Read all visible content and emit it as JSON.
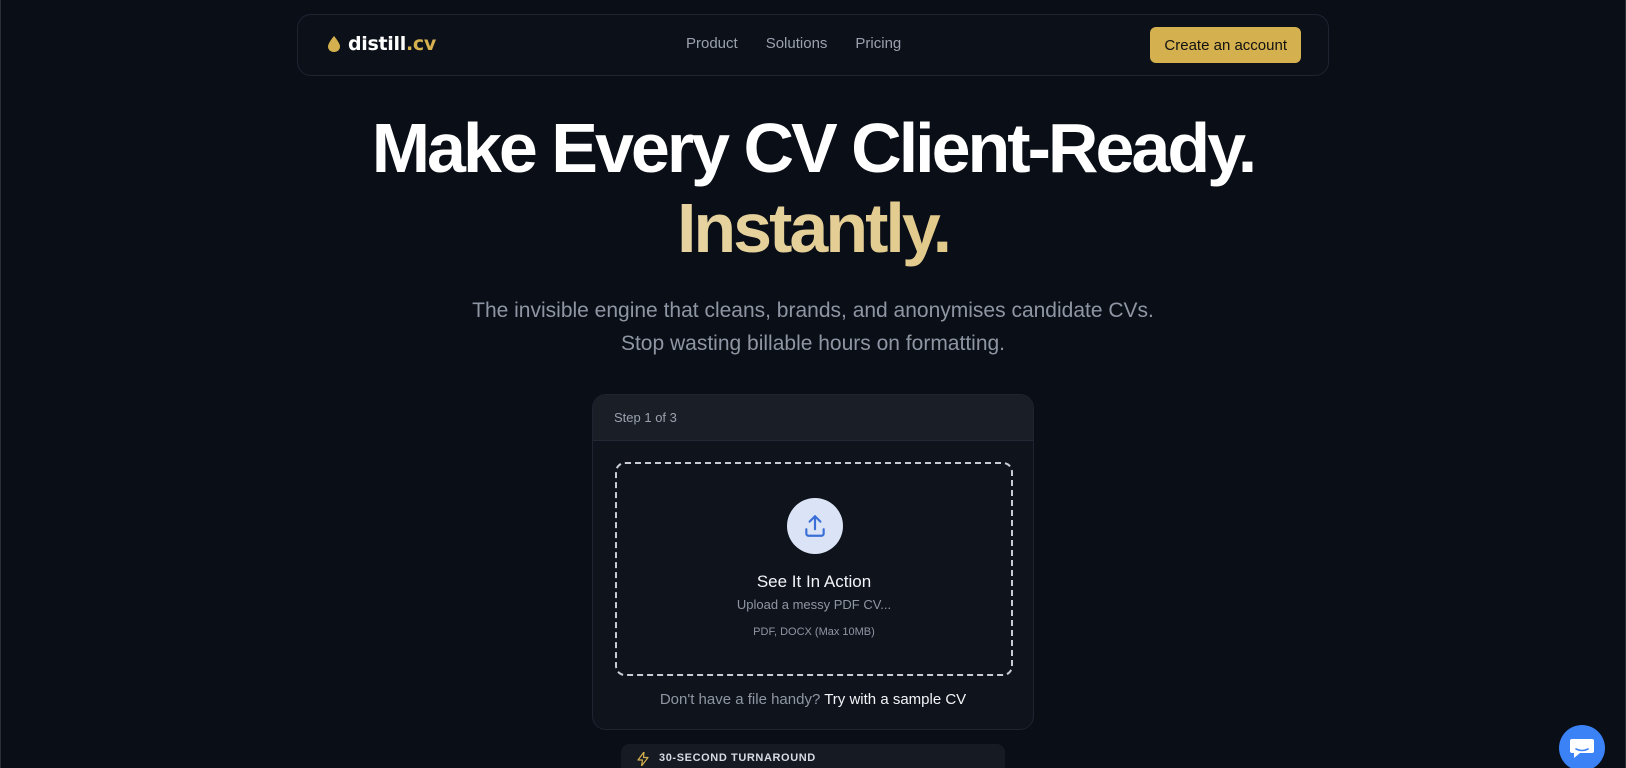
{
  "nav": {
    "logo_main": "distill",
    "logo_accent": ".cv",
    "links": [
      "Product",
      "Solutions",
      "Pricing"
    ],
    "cta_label": "Create an account"
  },
  "hero": {
    "title_line1": "Make Every CV Client-Ready.",
    "title_line2": "Instantly.",
    "subtitle": "The invisible engine that cleans, brands, and anonymises candidate CVs. Stop wasting billable hours on formatting."
  },
  "upload_card": {
    "step_label": "Step 1 of 3",
    "title": "See It In Action",
    "subtitle": "Upload a messy PDF CV...",
    "formats": "PDF, DOCX (Max 10MB)",
    "sample_prompt": "Don't have a file handy?",
    "sample_link": "Try with a sample CV"
  },
  "feature_badge": {
    "label": "30-SECOND TURNAROUND",
    "icon": "lightning-icon"
  },
  "chat": {
    "icon": "chat-icon"
  },
  "colors": {
    "background": "#0a0e17",
    "accent_gold": "#d4b04e",
    "chat_blue": "#3b82f6",
    "upload_icon_blue": "#3b6fd8"
  }
}
